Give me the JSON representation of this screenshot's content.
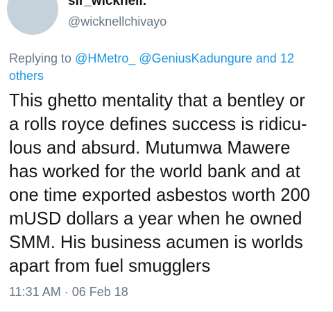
{
  "author": {
    "display_name": "sir_wicknell.",
    "handle": "@wicknellchivayo"
  },
  "reply": {
    "prefix": "Replying to ",
    "mention_1": "@HMetro_",
    "mention_2": "@GeniusKadungure",
    "and_text": " and ",
    "others_link_1": "12",
    "others_link_2": "others"
  },
  "tweet": {
    "lines": [
      "This ghetto mentality that a bentley or",
      "a rolls royce defines success is ridicu-",
      "lous and absurd. Mutumwa Mawere",
      "has worked for the world bank and at",
      "one time exported asbestos worth 200",
      "mUSD dollars a year when he owned",
      "SMM. His business acumen is worlds",
      "apart from fuel smugglers"
    ]
  },
  "meta": {
    "time": "11:31 AM",
    "separator": " · ",
    "date": "06 Feb 18"
  },
  "colors": {
    "text": "#14171a",
    "secondary": "#657786",
    "link": "#1b95e0",
    "avatar_placeholder": "#c5d2dc"
  }
}
